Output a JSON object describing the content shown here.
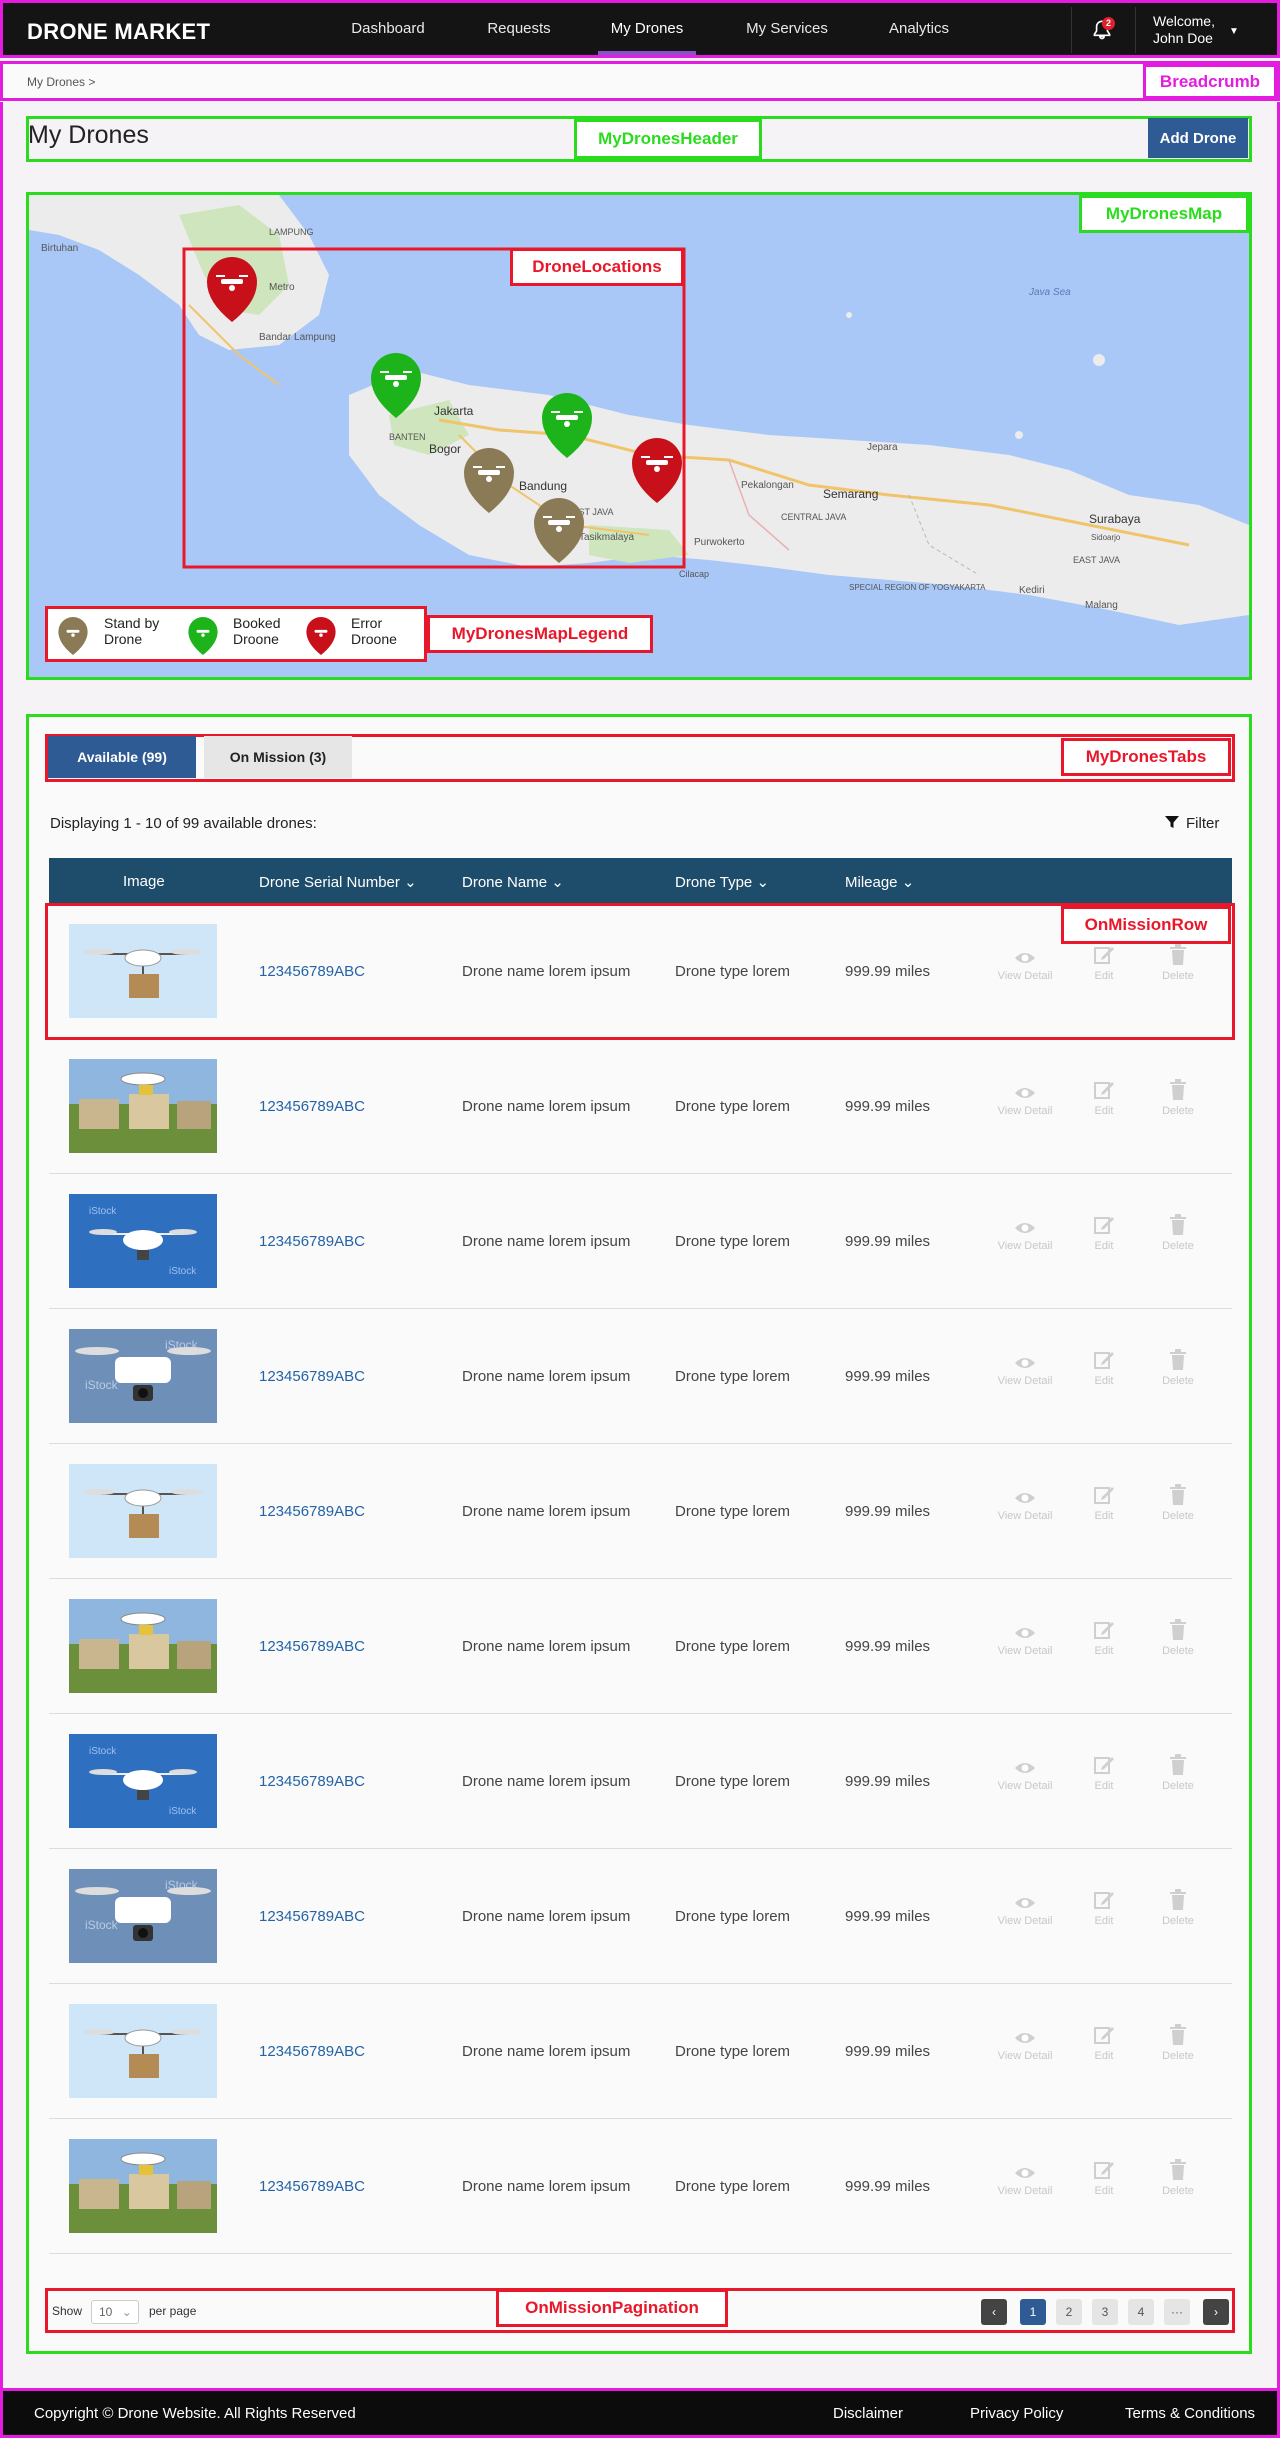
{
  "brand": "DRONE MARKET",
  "nav": {
    "items": [
      {
        "label": "Dashboard"
      },
      {
        "label": "Requests"
      },
      {
        "label": "My Drones"
      },
      {
        "label": "My Services"
      },
      {
        "label": "Analytics"
      }
    ],
    "active": "My Drones",
    "notification_count": "2",
    "user_line1": "Welcome,",
    "user_line2": "John Doe"
  },
  "breadcrumb": {
    "text": "My Drones  >",
    "anno": "Breadcrumb"
  },
  "header": {
    "title": "My Drones",
    "add_button": "Add Drone",
    "anno": "MyDronesHeader"
  },
  "map": {
    "anno": "MyDronesMap",
    "locations_anno": "DroneLocations",
    "legend_anno": "MyDronesMapLegend",
    "place_labels": [
      "Birtuhan",
      "LAMPUNG",
      "Metro",
      "Bandar Lampung",
      "Java Sea",
      "Jakarta",
      "BANTEN",
      "Bogor",
      "Bandung",
      "WEST JAVA",
      "Tasikmalaya",
      "Cilacap",
      "Purwokerto",
      "Pekalongan",
      "Semarang",
      "Jepara",
      "CENTRAL JAVA",
      "SPECIAL REGION OF YOGYAKARTA",
      "Surabaya",
      "Sidoarjo",
      "EAST JAVA",
      "Kediri",
      "Malang"
    ],
    "legend": [
      {
        "label_line1": "Stand by",
        "label_line2": "Drone",
        "color": "#8a7a55"
      },
      {
        "label_line1": "Booked",
        "label_line2": "Droone",
        "color": "#1db41b"
      },
      {
        "label_line1": "Error",
        "label_line2": "Droone",
        "color": "#c8101a"
      }
    ],
    "colors": {
      "water": "#a9c8f7",
      "land": "#ececec",
      "green": "#cfe5bd",
      "road": "#f0c46a"
    }
  },
  "tabs": {
    "available": "Available (99)",
    "mission": "On Mission (3)",
    "anno": "MyDronesTabs"
  },
  "list": {
    "display_text": "Displaying 1 - 10 of 99 available drones:",
    "filter_label": "Filter",
    "headers": {
      "image": "Image",
      "serial": "Drone Serial Number",
      "name": "Drone Name",
      "type": "Drone Type",
      "mileage": "Mileage"
    },
    "row_anno": "OnMissionRow",
    "actions": {
      "view": "View Detail",
      "edit": "Edit",
      "delete": "Delete"
    },
    "rows": [
      {
        "serial": "123456789ABC",
        "name": "Drone name lorem ipsum",
        "type": "Drone type lorem",
        "mileage": "999.99 miles",
        "image": "delivery"
      },
      {
        "serial": "123456789ABC",
        "name": "Drone name lorem ipsum",
        "type": "Drone type lorem",
        "mileage": "999.99 miles",
        "image": "houses"
      },
      {
        "serial": "123456789ABC",
        "name": "Drone name lorem ipsum",
        "type": "Drone type lorem",
        "mileage": "999.99 miles",
        "image": "bluesky"
      },
      {
        "serial": "123456789ABC",
        "name": "Drone name lorem ipsum",
        "type": "Drone type lorem",
        "mileage": "999.99 miles",
        "image": "closeup"
      },
      {
        "serial": "123456789ABC",
        "name": "Drone name lorem ipsum",
        "type": "Drone type lorem",
        "mileage": "999.99 miles",
        "image": "delivery"
      },
      {
        "serial": "123456789ABC",
        "name": "Drone name lorem ipsum",
        "type": "Drone type lorem",
        "mileage": "999.99 miles",
        "image": "houses"
      },
      {
        "serial": "123456789ABC",
        "name": "Drone name lorem ipsum",
        "type": "Drone type lorem",
        "mileage": "999.99 miles",
        "image": "bluesky"
      },
      {
        "serial": "123456789ABC",
        "name": "Drone name lorem ipsum",
        "type": "Drone type lorem",
        "mileage": "999.99 miles",
        "image": "closeup"
      },
      {
        "serial": "123456789ABC",
        "name": "Drone name lorem ipsum",
        "type": "Drone type lorem",
        "mileage": "999.99 miles",
        "image": "delivery"
      },
      {
        "serial": "123456789ABC",
        "name": "Drone name lorem ipsum",
        "type": "Drone type lorem",
        "mileage": "999.99 miles",
        "image": "houses"
      }
    ]
  },
  "pagination": {
    "anno": "OnMissionPagination",
    "show": "Show",
    "per_page_value": "10",
    "per_page_label": "per page",
    "pages": [
      "1",
      "2",
      "3",
      "4",
      "···"
    ],
    "current": "1"
  },
  "footer": {
    "copyright": "Copyright © Drone Website. All Rights Reserved",
    "disclaimer": "Disclaimer",
    "privacy": "Privacy Policy",
    "terms": "Terms & Conditions"
  }
}
